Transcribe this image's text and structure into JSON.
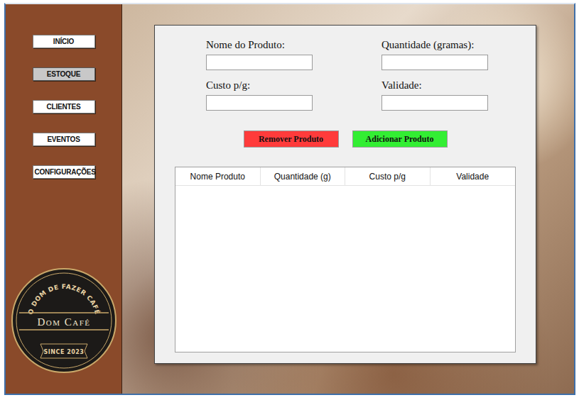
{
  "sidebar": {
    "items": [
      {
        "label": "INÍCIO",
        "selected": false
      },
      {
        "label": "ESTOQUE",
        "selected": true
      },
      {
        "label": "CLIENTES",
        "selected": false
      },
      {
        "label": "EVENTOS",
        "selected": false
      },
      {
        "label": "CONFIGURAÇÕES",
        "selected": false
      }
    ],
    "logo": {
      "top_text": "O DOM DE FAZER CAFÉ",
      "title": "Dom Café",
      "bottom_text": "SINCE 2023"
    }
  },
  "form": {
    "fields": [
      {
        "label": "Nome do Produto:",
        "value": ""
      },
      {
        "label": "Quantidade (gramas):",
        "value": ""
      },
      {
        "label": "Custo p/g:",
        "value": ""
      },
      {
        "label": "Validade:",
        "value": ""
      }
    ]
  },
  "buttons": [
    {
      "label": "Remover Produto",
      "color": "#ff3b3b"
    },
    {
      "label": "Adicionar Produto",
      "color": "#33ee33"
    }
  ],
  "table": {
    "columns": [
      "Nome Produto",
      "Quantidade (g)",
      "Custo p/g",
      "Validade"
    ],
    "rows": []
  }
}
